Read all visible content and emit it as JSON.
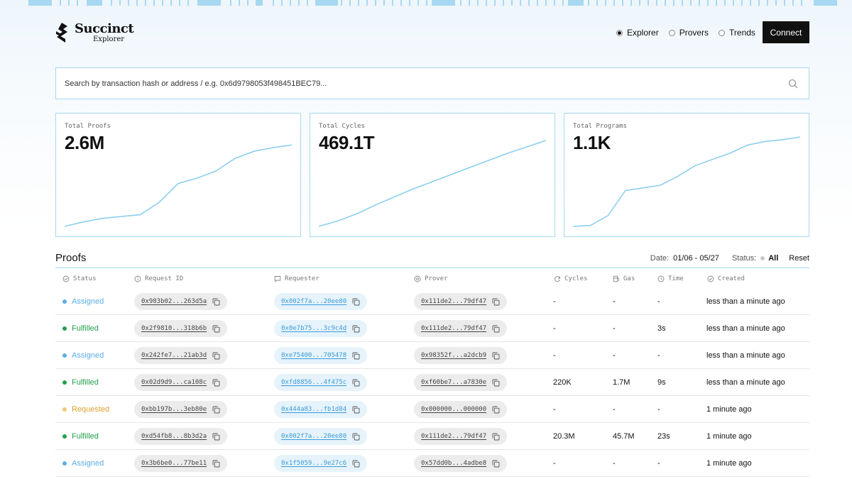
{
  "colors": {
    "accent": "#a7d8f2",
    "line": "#8ccff0",
    "assigned": "#5aaee6",
    "fulfilled": "#22a04b",
    "requested": "#e0a030",
    "requested_dot": "#f0c778"
  },
  "brand": {
    "name": "Succinct",
    "subtitle": "Explorer"
  },
  "nav": {
    "items": [
      {
        "label": "Explorer",
        "selected": true
      },
      {
        "label": "Provers",
        "selected": false
      },
      {
        "label": "Trends",
        "selected": false
      }
    ],
    "connect_label": "Connect"
  },
  "search": {
    "placeholder": "Search by transaction hash or address / e.g. 0x6d9798053f498451BEC79...",
    "icon": "search-icon"
  },
  "stats": [
    {
      "label": "Total Proofs",
      "value": "2.6M",
      "trend": [
        0,
        0.05,
        0.09,
        0.11,
        0.13,
        0.27,
        0.48,
        0.54,
        0.62,
        0.76,
        0.84,
        0.88,
        0.91
      ]
    },
    {
      "label": "Total Cycles",
      "value": "469.1T",
      "trend": [
        0,
        0.06,
        0.14,
        0.24,
        0.33,
        0.42,
        0.5,
        0.58,
        0.66,
        0.74,
        0.82,
        0.89,
        0.96
      ]
    },
    {
      "label": "Total Programs",
      "value": "1.1K",
      "trend": [
        0,
        0.01,
        0.12,
        0.4,
        0.43,
        0.46,
        0.56,
        0.68,
        0.75,
        0.82,
        0.91,
        0.95,
        0.97,
        1.0
      ]
    }
  ],
  "proofs": {
    "title": "Proofs",
    "date_label": "Date:",
    "date_value": "01/06 - 05/27",
    "status_label": "Status:",
    "status_value": "All",
    "reset_label": "Reset",
    "columns": [
      {
        "label": "Status",
        "icon": "check-circle-icon"
      },
      {
        "label": "Request ID",
        "icon": "info-circle-icon"
      },
      {
        "label": "Requester",
        "icon": "message-icon"
      },
      {
        "label": "Prover",
        "icon": "target-icon"
      },
      {
        "label": "Cycles",
        "icon": "refresh-icon"
      },
      {
        "label": "Gas",
        "icon": "fuel-icon"
      },
      {
        "label": "Time",
        "icon": "clock-icon"
      },
      {
        "label": "Created",
        "icon": "check-circle-icon"
      }
    ],
    "rows": [
      {
        "status": "Assigned",
        "request_id": "0x983b02...263d5a",
        "requester": "0x002f7a...20ee80",
        "prover": "0x111de2...79df47",
        "cycles": "-",
        "gas": "-",
        "time": "-",
        "created": "less than a minute ago"
      },
      {
        "status": "Fulfilled",
        "request_id": "0x2f9810...318b6b",
        "requester": "0x0e7b75...3c9c4d",
        "prover": "0x111de2...79df47",
        "cycles": "-",
        "gas": "-",
        "time": "3s",
        "created": "less than a minute ago"
      },
      {
        "status": "Assigned",
        "request_id": "0x242fe7...21ab3d",
        "requester": "0xe75400...705478",
        "prover": "0x98352f...a2dcb9",
        "cycles": "-",
        "gas": "-",
        "time": "-",
        "created": "less than a minute ago"
      },
      {
        "status": "Fulfilled",
        "request_id": "0x02d9d9...ca108c",
        "requester": "0xfd8856...4f475c",
        "prover": "0xf60be7...a7830e",
        "cycles": "220K",
        "gas": "1.7M",
        "time": "9s",
        "created": "less than a minute ago"
      },
      {
        "status": "Requested",
        "request_id": "0xbb197b...3eb80e",
        "requester": "0x444a83...fb1d84",
        "prover": "0x000000...000000",
        "cycles": "-",
        "gas": "-",
        "time": "-",
        "created": "1 minute ago"
      },
      {
        "status": "Fulfilled",
        "request_id": "0xd54fb8...8b3d2a",
        "requester": "0x002f7a...20ee80",
        "prover": "0x111de2...79df47",
        "cycles": "20.3M",
        "gas": "45.7M",
        "time": "23s",
        "created": "1 minute ago"
      },
      {
        "status": "Assigned",
        "request_id": "0x3b6be0...77be11",
        "requester": "0x1f5059...9e27c6",
        "prover": "0x57dd0b...4adbe8",
        "cycles": "-",
        "gas": "-",
        "time": "-",
        "created": "1 minute ago"
      }
    ]
  }
}
